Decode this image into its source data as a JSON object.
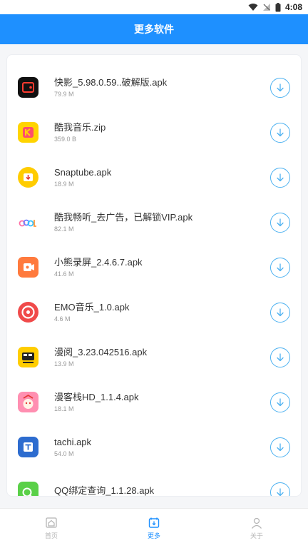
{
  "status": {
    "time": "4:08"
  },
  "header": {
    "title": "更多软件"
  },
  "apps": [
    {
      "name": "快影_5.98.0.59..破解版.apk",
      "size": "79.9 M",
      "icon": "kuaiying-icon"
    },
    {
      "name": "酷我音乐.zip",
      "size": "359.0 B",
      "icon": "kuwo-music-icon"
    },
    {
      "name": "Snaptube.apk",
      "size": "18.9 M",
      "icon": "snaptube-icon"
    },
    {
      "name": "酷我畅听_去广告，已解锁VIP.apk",
      "size": "82.1 M",
      "icon": "kuwo-listen-icon"
    },
    {
      "name": "小熊录屏_2.4.6.7.apk",
      "size": "41.6 M",
      "icon": "bear-recorder-icon"
    },
    {
      "name": "EMO音乐_1.0.apk",
      "size": "4.6 M",
      "icon": "emo-music-icon"
    },
    {
      "name": "漫阅_3.23.042516.apk",
      "size": "13.9 M",
      "icon": "manyue-icon"
    },
    {
      "name": "漫客栈HD_1.1.4.apk",
      "size": "18.1 M",
      "icon": "mankezhan-icon"
    },
    {
      "name": "tachi.apk",
      "size": "54.0 M",
      "icon": "tachi-icon"
    },
    {
      "name": "QQ绑定查询_1.1.28.apk",
      "size": "",
      "icon": "qq-query-icon"
    }
  ],
  "tabs": [
    {
      "label": "首页",
      "icon": "home-icon"
    },
    {
      "label": "更多",
      "icon": "more-icon"
    },
    {
      "label": "关于",
      "icon": "user-icon"
    }
  ],
  "colors": {
    "primary": "#1e90ff",
    "download": "#4db1f0"
  }
}
